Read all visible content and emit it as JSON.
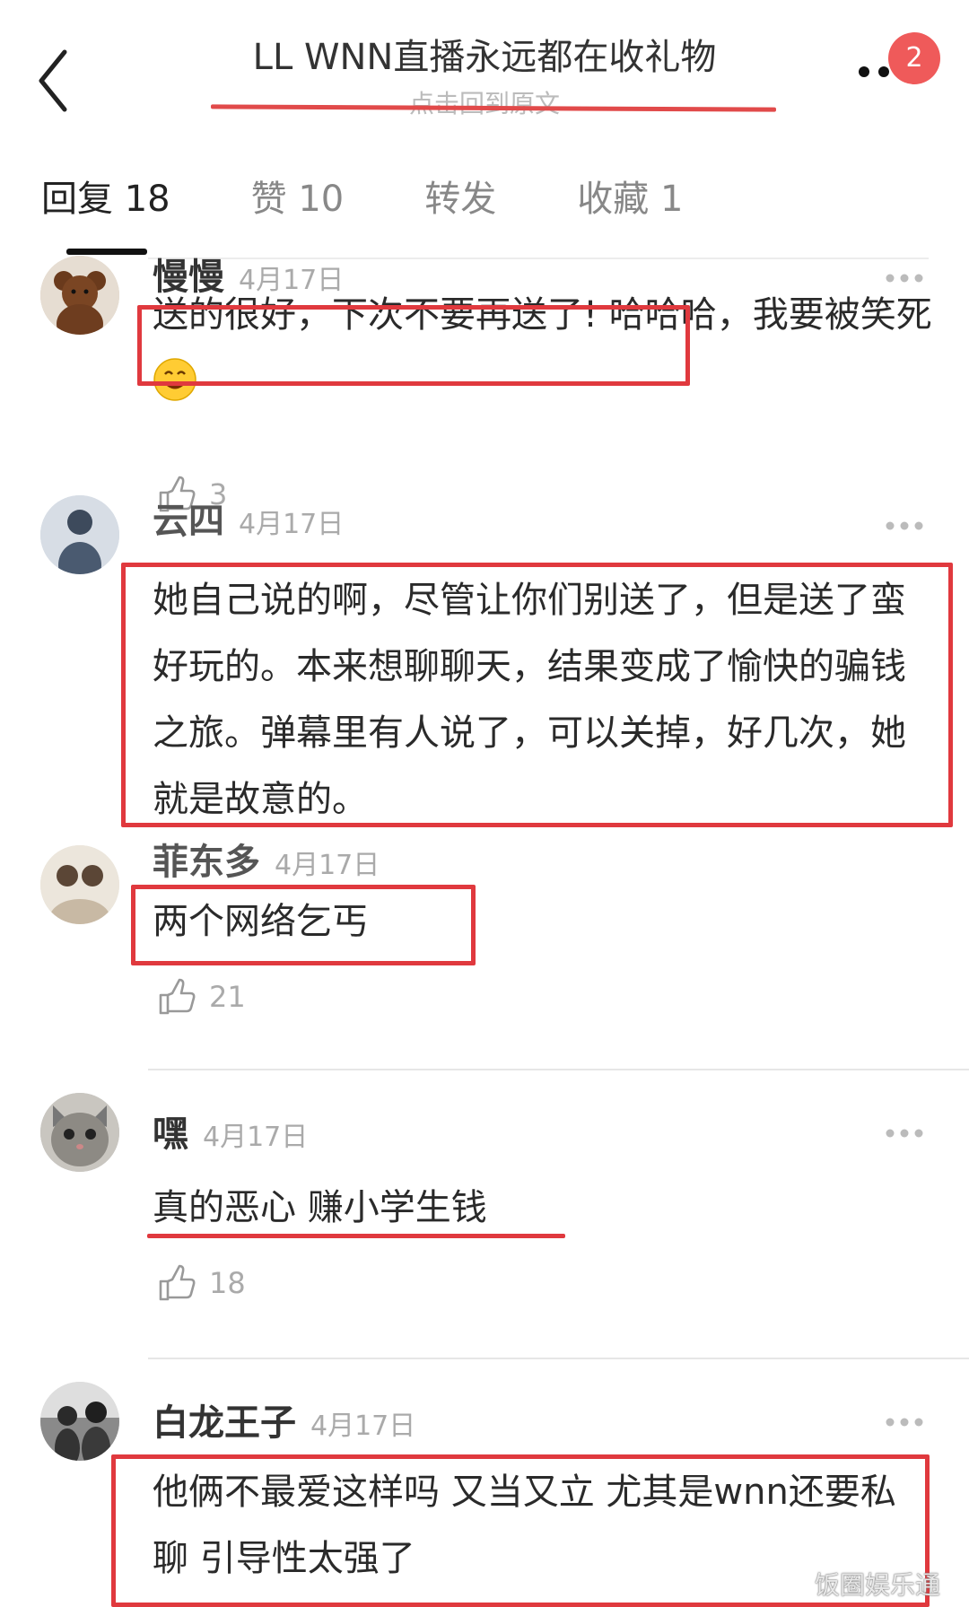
{
  "header": {
    "title": "LL WNN直播永远都在收礼物",
    "subtitle": "点击回到原文",
    "badge_count": "2",
    "back_icon": "chevron-left-icon",
    "more_icon": "more-dots-icon"
  },
  "tabs": [
    {
      "label": "回复 18",
      "active": true
    },
    {
      "label": "赞 10",
      "active": false
    },
    {
      "label": "转发",
      "active": false
    },
    {
      "label": "收藏 1",
      "active": false
    }
  ],
  "comments": [
    {
      "name": "慢慢",
      "date": "4月17日",
      "text_highlighted": "送的很好，下次不要再送了!",
      "text_rest": "哈哈哈，我要被笑死",
      "emoji": "grinning-face-icon",
      "likes": "3"
    },
    {
      "name": "云四",
      "date": "4月17日",
      "text": "她自己说的啊，尽管让你们别送了，但是送了蛮好玩的。本来想聊聊天，结果变成了愉快的骗钱之旅。弹幕里有人说了，可以关掉，好几次，她就是故意的。"
    },
    {
      "name": "菲东多",
      "date": "4月17日",
      "text": "两个网络乞丐",
      "likes": "21"
    },
    {
      "name": "嘿",
      "date": "4月17日",
      "text": "真的恶心 赚小学生钱",
      "likes": "18"
    },
    {
      "name": "白龙王子",
      "date": "4月17日",
      "text": "他俩不最爱这样吗 又当又立 尤其是wnn还要私聊 引导性太强了"
    }
  ],
  "watermark": "饭圈娱乐通",
  "colors": {
    "annotation_red": "#e0393e",
    "badge_red": "#ef5a5a",
    "muted_text": "#aaaaaa"
  }
}
